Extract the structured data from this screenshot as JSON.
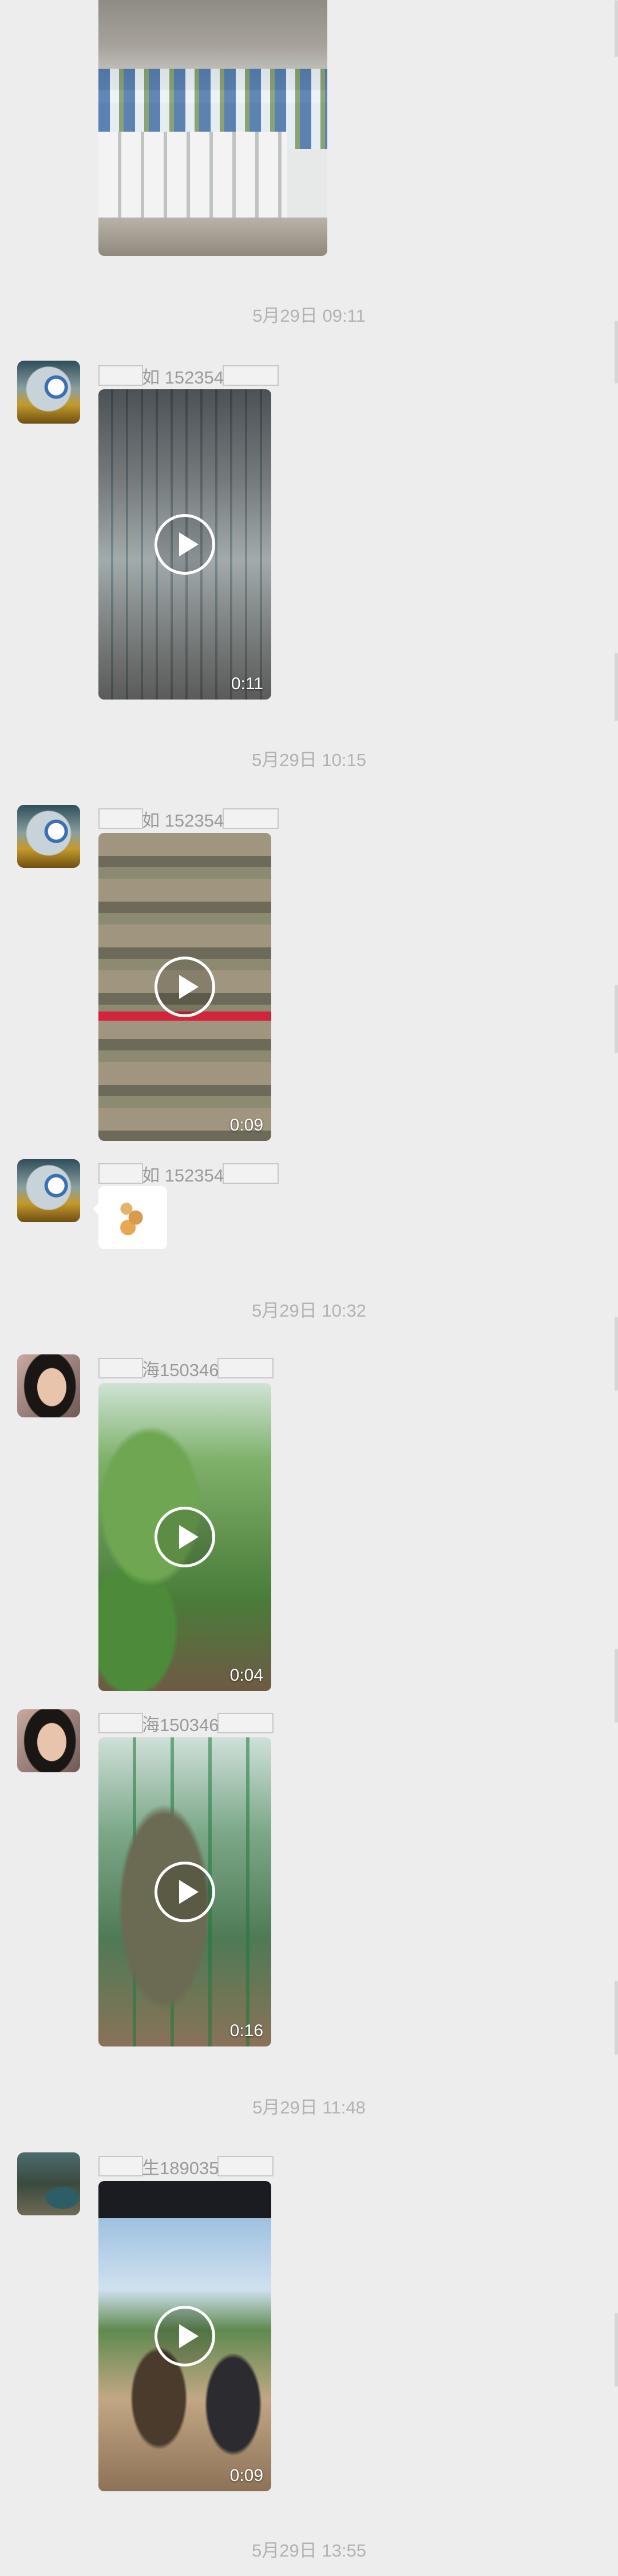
{
  "timestamps": [
    "5月29日 09:11",
    "5月29日 10:15",
    "5月29日 10:32",
    "5月29日 11:48",
    "5月29日 13:55"
  ],
  "messages": [
    {
      "type": "image",
      "sender": "",
      "description": ""
    },
    {
      "type": "video",
      "sender_visible": "如 152354",
      "duration": "0:11"
    },
    {
      "type": "video",
      "sender_visible": "如 152354",
      "duration": "0:09"
    },
    {
      "type": "sticker",
      "sender_visible": "如 152354"
    },
    {
      "type": "video",
      "sender_visible": "海150346",
      "duration": "0:04"
    },
    {
      "type": "video",
      "sender_visible": "海150346",
      "duration": "0:16"
    },
    {
      "type": "video",
      "sender_visible": "生189035",
      "duration": "0:09"
    }
  ]
}
